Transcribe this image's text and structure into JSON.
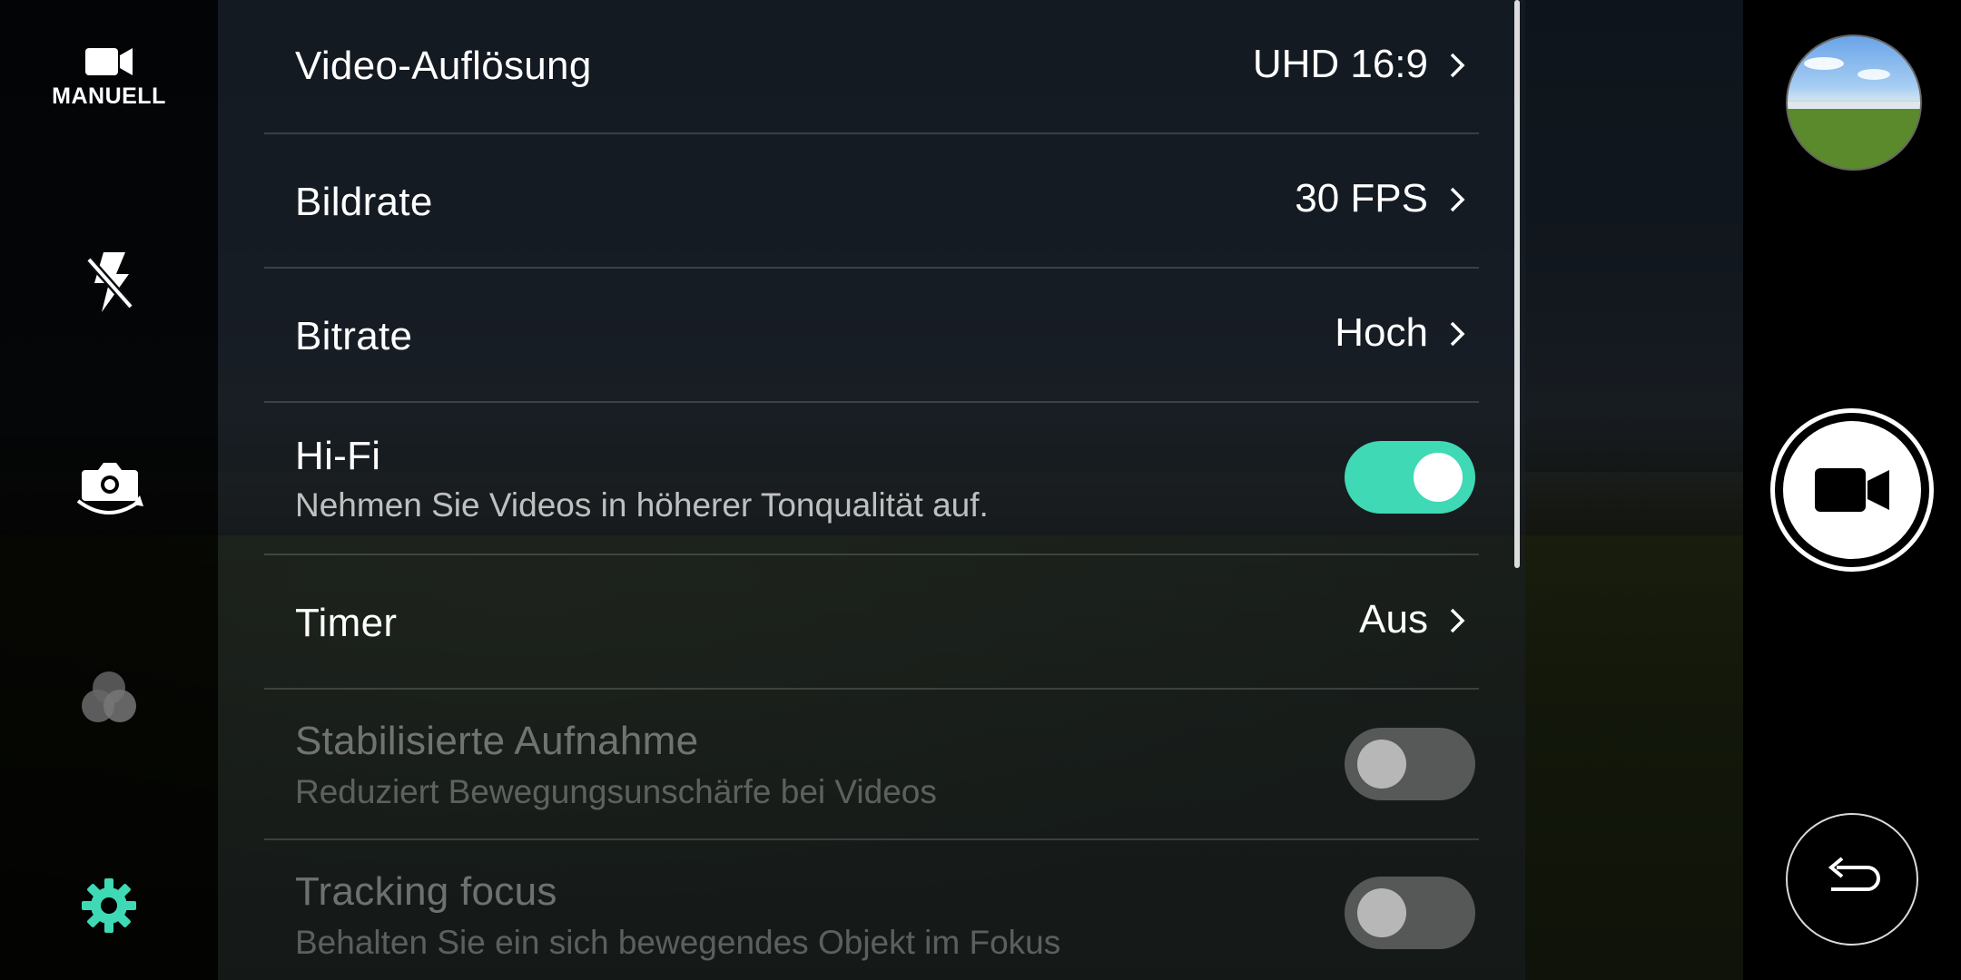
{
  "left_rail": {
    "mode_icon": "video-camera-icon",
    "mode_label": "MANUELL",
    "flash_icon": "flash-off-icon",
    "switch_camera_icon": "switch-camera-icon",
    "filter_icon": "filter-icon",
    "settings_icon": "gear-icon"
  },
  "settings": {
    "items": [
      {
        "title": "Video-Auflösung",
        "value": "UHD 16:9"
      },
      {
        "title": "Bildrate",
        "value": "30 FPS"
      },
      {
        "title": "Bitrate",
        "value": "Hoch"
      },
      {
        "title": "Hi-Fi",
        "subtitle": "Nehmen Sie Videos in höherer Tonqualität auf.",
        "toggle": "on"
      },
      {
        "title": "Timer",
        "value": "Aus"
      },
      {
        "title": "Stabilisierte Aufnahme",
        "subtitle": "Reduziert Bewegungsunschärfe bei Videos",
        "toggle": "off",
        "disabled": true
      },
      {
        "title": "Tracking focus",
        "subtitle": "Behalten Sie ein sich bewegendes Objekt im Fokus",
        "toggle": "off",
        "disabled": true
      }
    ]
  },
  "right_rail": {
    "gallery_icon": "gallery-thumbnail",
    "record_icon": "video-record-icon",
    "back_icon": "back-arrow-icon"
  },
  "colors": {
    "accent": "#3fd9b5",
    "panel": "#12161c"
  }
}
